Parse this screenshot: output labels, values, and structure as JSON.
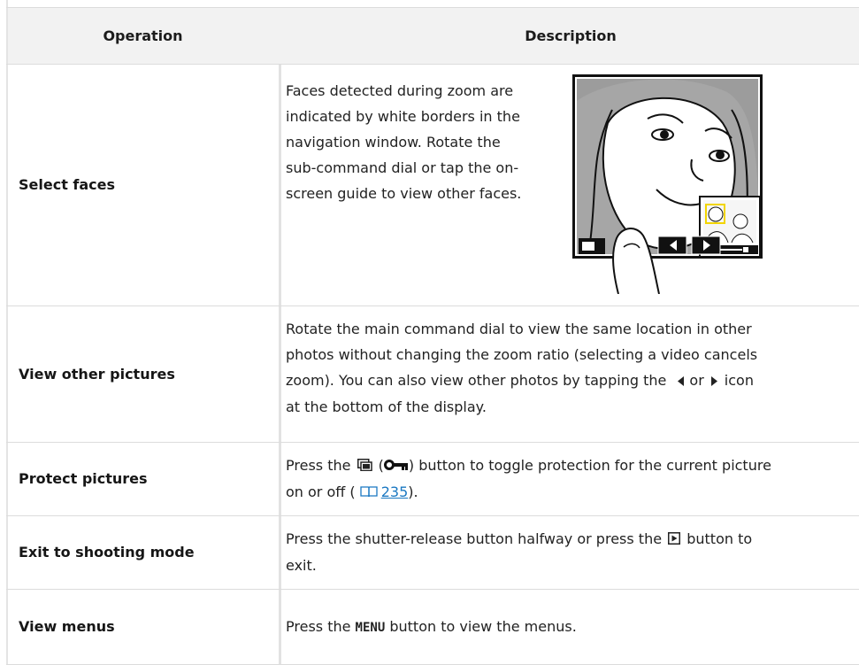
{
  "table": {
    "headers": {
      "operation": "Operation",
      "description": "Description"
    },
    "rows": [
      {
        "operation": "Select faces",
        "description": "Faces detected during zoom are indicated by white borders in the navigation window. Rotate the sub-command dial or tap the on-screen guide to view other faces.",
        "lines": [
          "Faces detected during zoom are",
          "indicated by white borders in the",
          "navigation window. Rotate the",
          "sub-command dial or tap the on-",
          "screen guide to view other faces."
        ]
      },
      {
        "operation": "View other pictures",
        "lines": [
          "Rotate the main command dial to view the same location in other",
          "photos without changing the zoom ratio (selecting a video cancels",
          "zoom). You can also view other photos by tapping the",
          "or",
          "icon",
          "at the bottom of the display."
        ]
      },
      {
        "operation": "Protect pictures",
        "line1_a": "Press the",
        "line1_b": "(",
        "line1_c": ") button to toggle protection for the current picture",
        "line2_a": "on or off (",
        "page_ref": "235",
        "line2_b": ")."
      },
      {
        "operation": "Exit to shooting mode",
        "line1_a": "Press the shutter-release button halfway or press the",
        "line1_b": "button to",
        "line2": "exit."
      },
      {
        "operation": "View menus",
        "line1_a": "Press the",
        "menu_word": "MENU",
        "line1_b": "button to view the menus."
      }
    ]
  },
  "icons": {
    "left_arrow": "left-triangle-icon",
    "right_arrow": "right-triangle-icon",
    "protect_button": "protect-button-icon",
    "key": "key-icon",
    "playback": "playback-button-icon",
    "book": "book-icon"
  },
  "colors": {
    "header_bg": "#f2f2f2",
    "link": "#1a78c2",
    "highlight_frame": "#f2d500"
  }
}
